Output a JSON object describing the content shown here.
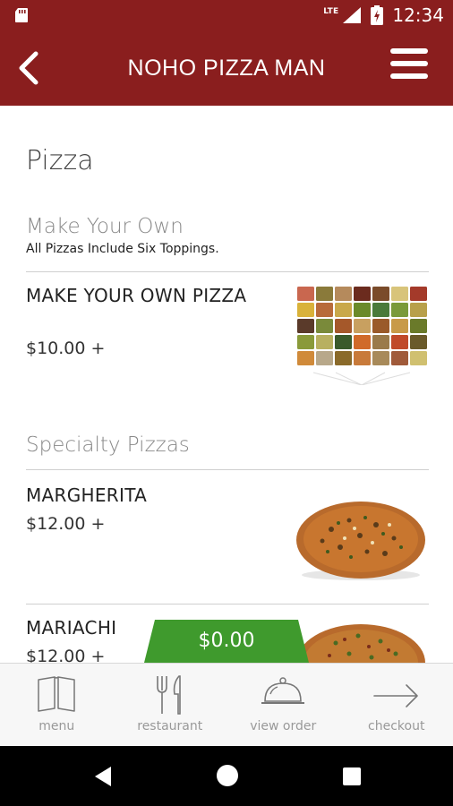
{
  "status_bar": {
    "network": "LTE",
    "time": "12:34",
    "icons": [
      "sd-card-icon",
      "signal-icon",
      "battery-icon"
    ]
  },
  "app_bar": {
    "title": "NOHO PIZZA MAN",
    "icons": [
      "back-arrow-icon",
      "hamburger-menu-icon"
    ]
  },
  "colors": {
    "brand": "#8a1e1e",
    "cart_badge": "#3f9a2d"
  },
  "page": {
    "title": "Pizza"
  },
  "sections": [
    {
      "title": "Make Your Own",
      "subtitle": "All Pizzas Include Six Toppings.",
      "items": [
        {
          "name": "MAKE YOUR OWN PIZZA",
          "price": "$10.00 +",
          "image": "toppings-grid-image"
        }
      ]
    },
    {
      "title": "Specialty Pizzas",
      "subtitle": "",
      "items": [
        {
          "name": "MARGHERITA",
          "price": "$12.00 +",
          "image": "pizza-image"
        },
        {
          "name": "MARIACHI",
          "price": "$12.00 +",
          "image": "pizza-image"
        }
      ]
    }
  ],
  "cart": {
    "total": "$0.00"
  },
  "bottom_nav": [
    {
      "label": "menu",
      "icon": "open-book-icon"
    },
    {
      "label": "restaurant",
      "icon": "fork-knife-icon"
    },
    {
      "label": "view order",
      "icon": "cloche-icon"
    },
    {
      "label": "checkout",
      "icon": "arrow-right-icon"
    }
  ]
}
